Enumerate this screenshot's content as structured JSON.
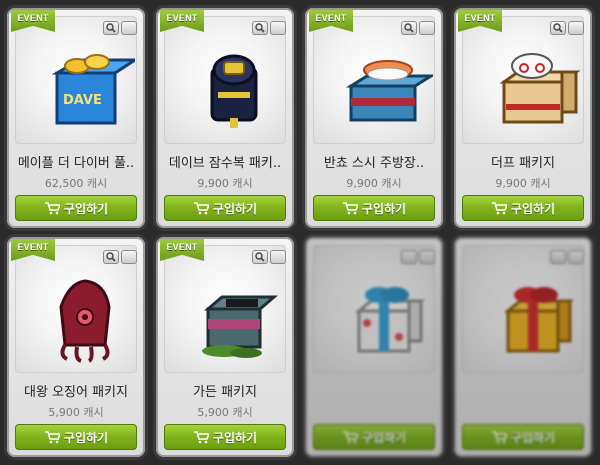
{
  "labels": {
    "badge": "EVENT",
    "buy": "구입하기"
  },
  "items": [
    {
      "name": "메이플 더 다이버 풀..",
      "price": "62,500 캐시",
      "badge": true,
      "dim": false
    },
    {
      "name": "데이브 잠수복 패키..",
      "price": "9,900 캐시",
      "badge": true,
      "dim": false
    },
    {
      "name": "반쵸 스시 주방장..",
      "price": "9,900 캐시",
      "badge": true,
      "dim": false
    },
    {
      "name": "더프 패키지",
      "price": "9,900 캐시",
      "badge": true,
      "dim": false
    },
    {
      "name": "대왕 오징어 패키지",
      "price": "5,900 캐시",
      "badge": true,
      "dim": false
    },
    {
      "name": "가든 패키지",
      "price": "5,900 캐시",
      "badge": true,
      "dim": false
    },
    {
      "name": "",
      "price": "",
      "badge": false,
      "dim": true
    },
    {
      "name": "",
      "price": "",
      "badge": false,
      "dim": true
    }
  ],
  "icons": {
    "zoom": "magnifier-icon",
    "wish": "wishlist-icon",
    "cart": "cart-icon"
  },
  "colors": {
    "accent_green": "#7fb31a",
    "ribbon_green": "#8fbf2e"
  }
}
